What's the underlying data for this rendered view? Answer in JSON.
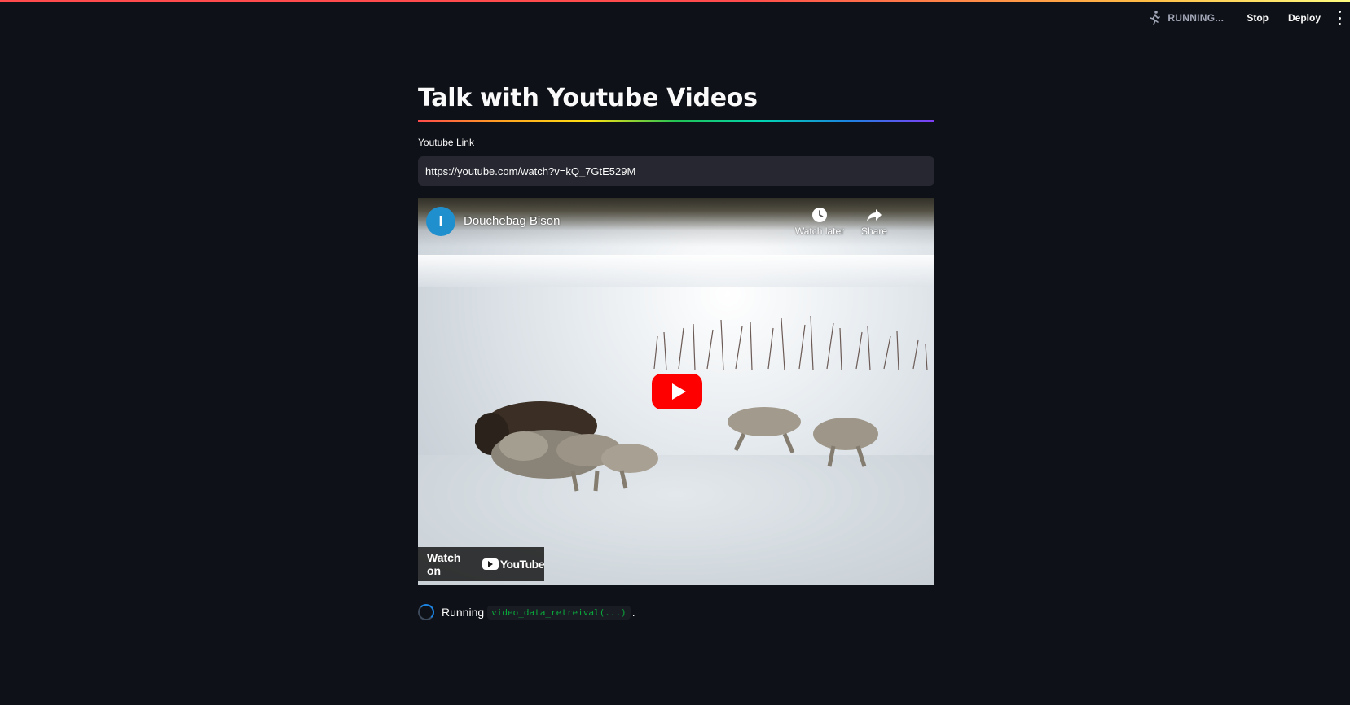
{
  "topbar": {
    "status_text": "RUNNING...",
    "stop_label": "Stop",
    "deploy_label": "Deploy"
  },
  "page": {
    "title": "Talk with Youtube Videos"
  },
  "input": {
    "label": "Youtube Link",
    "value": "https://youtube.com/watch?v=kQ_7GtE529M"
  },
  "video": {
    "channel_initial": "I",
    "title": "Douchebag Bison",
    "watch_later_label": "Watch later",
    "share_label": "Share",
    "watch_on_label": "Watch on",
    "youtube_word": "YouTube"
  },
  "status": {
    "running_label": "Running",
    "function_call": "video_data_retreival(...)",
    "suffix": "."
  },
  "colors": {
    "background": "#0e1117",
    "input_bg": "#262730",
    "youtube_red": "#ff0000",
    "code_green": "#09ab3b",
    "spinner_blue": "#1c83e1"
  }
}
